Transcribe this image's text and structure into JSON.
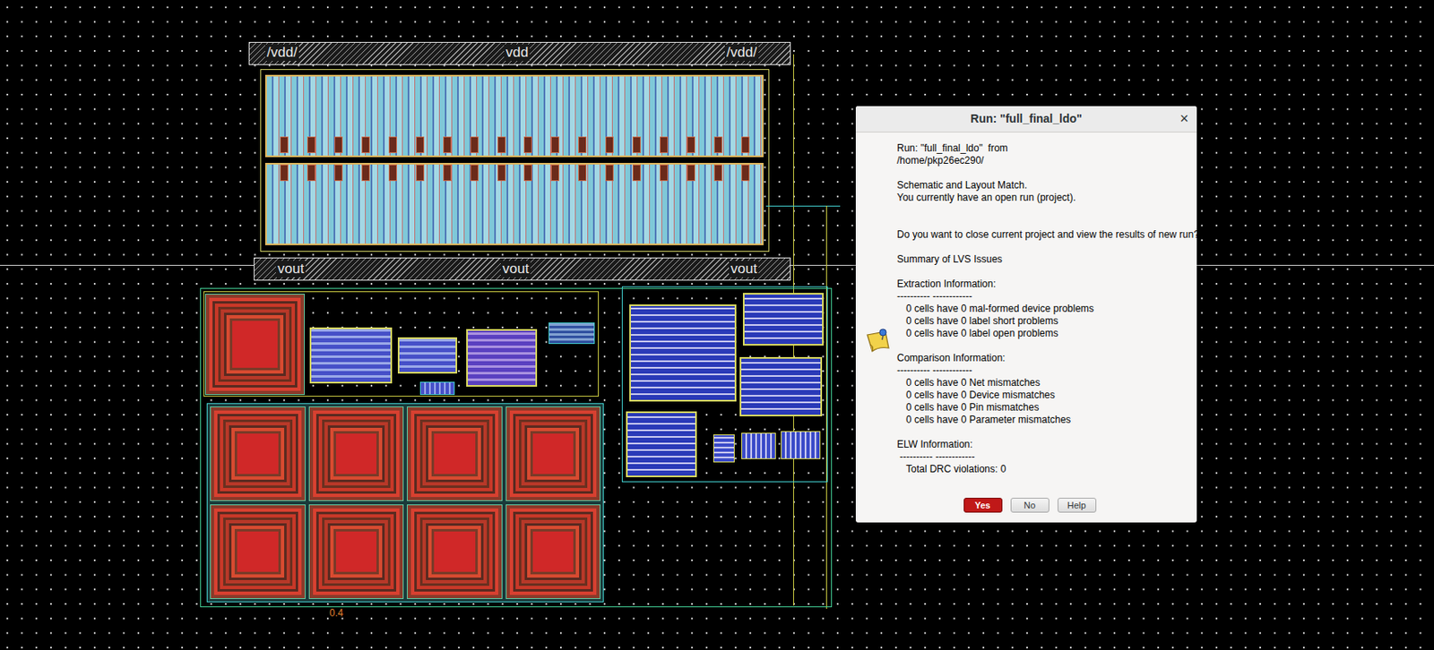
{
  "layout": {
    "vdd_labels": [
      "/vdd/",
      "vdd",
      "/vdd/"
    ],
    "vout_labels": [
      "vout",
      "vout",
      "vout"
    ],
    "dimension": "0.4"
  },
  "dialog": {
    "title": "Run: \"full_final_ldo\"",
    "close": "×",
    "run": [
      "Run: \"full_final_ldo\"  from",
      "/home/pkp26ec290/"
    ],
    "status": [
      "Schematic and Layout Match.",
      "You currently have an open run (project)."
    ],
    "question": "Do you want to close current project and view the results of new run?",
    "summary": "Summary of LVS Issues",
    "sections": [
      {
        "heading": "Extraction Information:",
        "rule": "---------- ------------",
        "items": [
          "0 cells have 0 mal-formed device problems",
          "0 cells have 0 label short problems",
          "0 cells have 0 label open problems"
        ]
      },
      {
        "heading": "Comparison Information:",
        "rule": "---------- ------------",
        "items": [
          "0 cells have 0 Net mismatches",
          "0 cells have 0 Device mismatches",
          "0 cells have 0 Pin mismatches",
          "0 cells have 0 Parameter mismatches"
        ]
      },
      {
        "heading": "ELW Information:",
        "rule": " ---------- ------------",
        "items": [
          "Total DRC violations: 0"
        ]
      }
    ],
    "buttons": [
      {
        "label": "Yes",
        "default": true
      },
      {
        "label": "No",
        "default": false
      },
      {
        "label": "Help",
        "default": false
      }
    ]
  }
}
